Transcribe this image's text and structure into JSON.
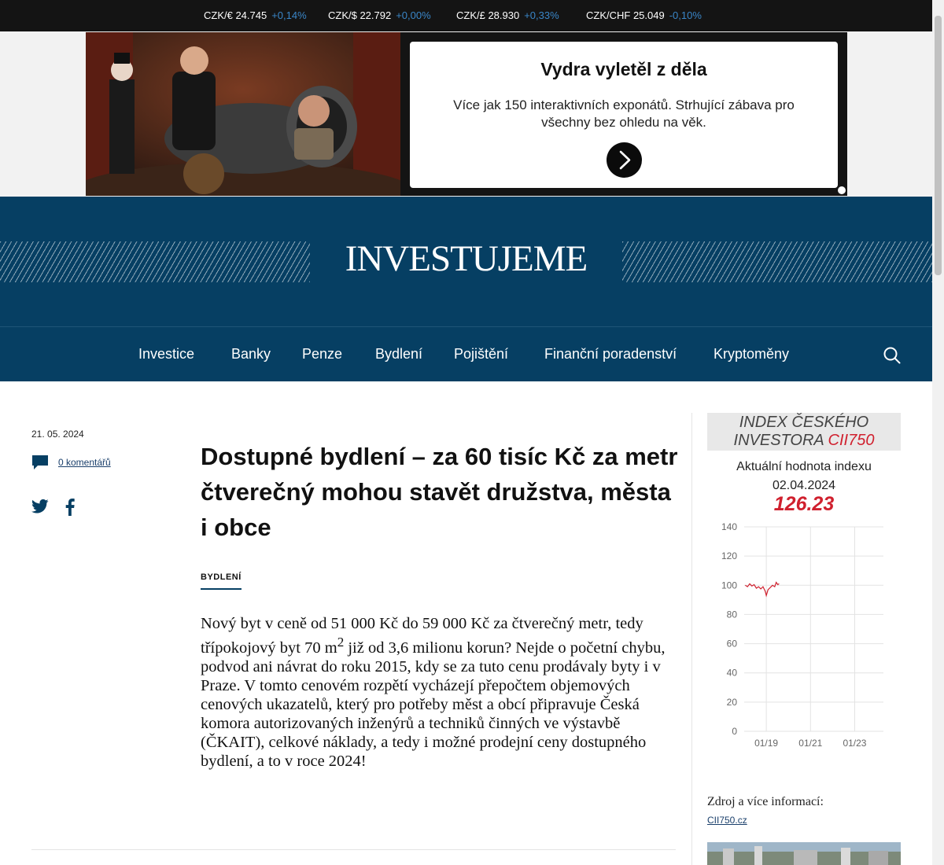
{
  "ticker": [
    {
      "pair": "CZK/€ 24.745",
      "change": "+0,14%"
    },
    {
      "pair": "CZK/$ 22.792",
      "change": "+0,00%"
    },
    {
      "pair": "CZK/£ 28.930",
      "change": "+0,33%"
    },
    {
      "pair": "CZK/CHF 25.049",
      "change": "-0,10%"
    }
  ],
  "ad": {
    "title": "Vydra vyletěl z děla",
    "text": "Více jak 150 interaktivních exponátů. Strhující zábava pro všechny bez ohledu na věk."
  },
  "header": {
    "logo": "INVESTUJEME"
  },
  "nav": [
    "Investice",
    "Banky",
    "Penze",
    "Bydlení",
    "Pojištění",
    "Finanční poradenství",
    "Kryptoměny"
  ],
  "article": {
    "date": "21. 05. 2024",
    "comments": "0 komentářů",
    "title": "Dostupné bydlení – za 60 tisíc Kč za metr čtverečný mohou stavět družstva, města i obce",
    "category": "BYDLENÍ",
    "lead_before_sup": "Nový byt v ceně od 51 000 Kč do 59 000 Kč za čtverečný metr, tedy třípokojový byt 70 m",
    "lead_sup": "2",
    "lead_after_sup": " již od 3,6 milionu korun? Nejde o početní chybu, podvod ani návrat do roku 2015, kdy se za tuto cenu prodávaly byty i v Praze. V tomto cenovém rozpětí vycházejí přepočtem objemových cenových ukazatelů, který pro potřeby měst a obcí připravuje Česká komora autorizovaných inženýrů a techniků činných ve výstavbě (ČKAIT), celkové náklady, a tedy i možné prodejní ceny dostupného bydlení, a to v roce 2024!"
  },
  "widget": {
    "title_line1": "INDEX ČESKÉHO",
    "title_line2": "INVESTORA ",
    "title_highlight": "CII750",
    "subtitle_line1": "Aktuální hodnota indexu",
    "subtitle_line2": "02.04.2024",
    "value": "126.23",
    "source_label": "Zdroj a více informací:",
    "source_link": "CII750.cz"
  },
  "colors": {
    "header_bg": "#063f63",
    "accent_red": "#d0202e",
    "ticker_bg": "#141414",
    "ticker_change": "#3a86c8"
  },
  "chart_data": {
    "type": "line",
    "ylim": [
      0,
      140
    ],
    "yticks": [
      0,
      20,
      40,
      60,
      80,
      100,
      120,
      140
    ],
    "xticks": [
      {
        "label": "01/19",
        "t": 2019.0
      },
      {
        "label": "01/21",
        "t": 2021.0
      },
      {
        "label": "01/23",
        "t": 2023.0
      }
    ],
    "xlim": [
      2018.0,
      2024.3
    ],
    "series": [
      {
        "color": "#d0202e",
        "points": [
          [
            2018.05,
            100
          ],
          [
            2018.15,
            99
          ],
          [
            2018.25,
            101
          ],
          [
            2018.35,
            99.5
          ],
          [
            2018.45,
            100.5
          ],
          [
            2018.55,
            98
          ],
          [
            2018.65,
            99
          ],
          [
            2018.75,
            97.5
          ],
          [
            2018.85,
            99
          ],
          [
            2018.95,
            96
          ],
          [
            2019.0,
            93
          ],
          [
            2019.08,
            97
          ],
          [
            2019.18,
            98.5
          ],
          [
            2019.28,
            100
          ],
          [
            2019.38,
            99
          ],
          [
            2019.45,
            102
          ],
          [
            2019.52,
            100.5
          ],
          [
            2019.58,
            101
          ]
        ]
      }
    ]
  }
}
